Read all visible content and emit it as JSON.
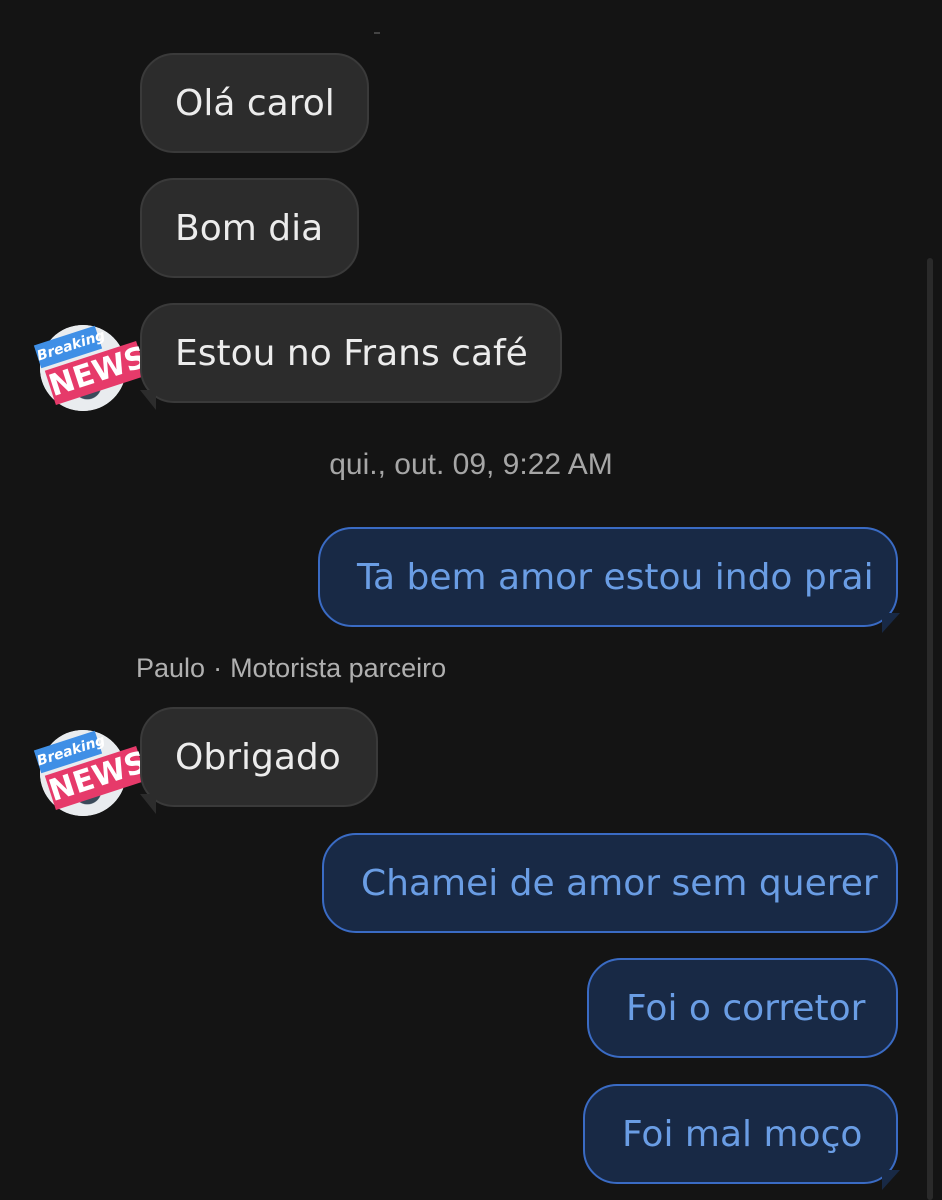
{
  "conversation": {
    "messages": [
      {
        "text": "Olá carol"
      },
      {
        "text": "Bom dia"
      },
      {
        "text": "Estou no Frans café"
      },
      {
        "text": "Ta bem amor estou indo prai"
      },
      {
        "text": "Obrigado"
      },
      {
        "text": "Chamei de amor sem querer"
      },
      {
        "text": "Foi o corretor"
      },
      {
        "text": "Foi mal moço"
      }
    ],
    "timestamp": "qui., out. 09, 9:22 AM",
    "sender": {
      "name": "Paulo",
      "separator": "·",
      "role": "Motorista parceiro"
    },
    "avatar": {
      "icon": "breaking-news-avatar-icon",
      "line1": "Breaking",
      "line2": "NEWS"
    }
  },
  "colors": {
    "background": "#141414",
    "incoming_bubble": "#2c2c2c",
    "outgoing_bubble": "#182945",
    "outgoing_border": "#3a6bc4",
    "outgoing_text": "#6a9de4"
  }
}
